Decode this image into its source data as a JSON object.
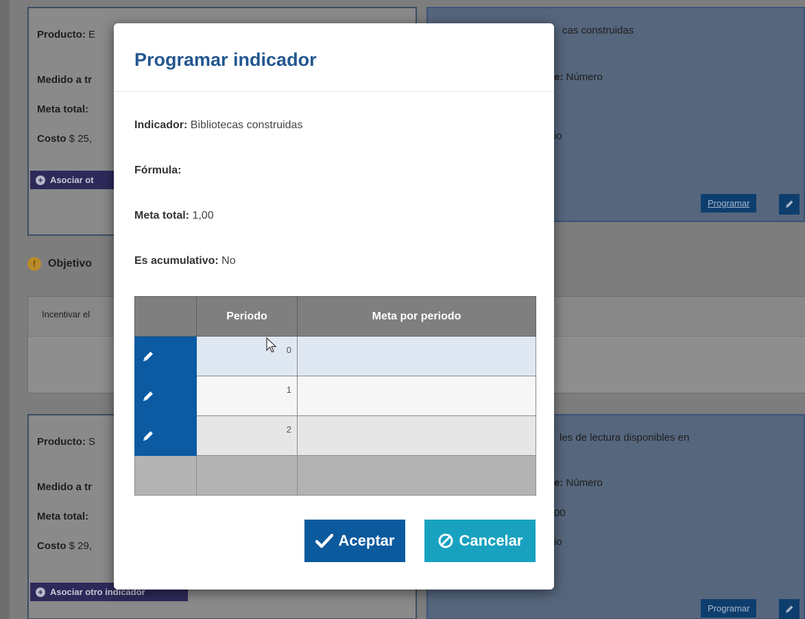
{
  "background": {
    "card1": {
      "producto_label": "Producto:",
      "producto_value": "E",
      "medido_label": "Medido a tr",
      "meta_label": "Meta total:",
      "costo_label": "Costo",
      "costo_value": "$ 25,",
      "assoc_label": "Asociar ot"
    },
    "card2": {
      "title_fragment": "cas construidas",
      "unidad_fragment": "e:",
      "unidad_value": "Número",
      "other_fragment": "io",
      "programar_label": "Programar"
    },
    "objective": {
      "label": "Objetivo",
      "text": "Incentivar el"
    },
    "card3": {
      "producto_label": "Producto:",
      "producto_value": "S",
      "medido_label": "Medido a tr",
      "meta_label": "Meta total:",
      "costo_label": "Costo",
      "costo_value": "$ 29,",
      "assoc_label": "Asociar otro indicador"
    },
    "card4": {
      "title_fragment": "les de lectura disponibles en",
      "unidad_fragment": "e:",
      "unidad_value": "Número",
      "value_fragment": "00",
      "other_fragment": "io",
      "programar_label": "Programar"
    }
  },
  "modal": {
    "title": "Programar indicador",
    "indicador": {
      "label": "Indicador:",
      "value": "Bibliotecas construidas"
    },
    "formula": {
      "label": "Fórmula:",
      "value": ""
    },
    "meta_total": {
      "label": "Meta total:",
      "value": "1,00"
    },
    "acumulativo": {
      "label": "Es acumulativo:",
      "value": "No"
    },
    "grid": {
      "columns": [
        "",
        "Periodo",
        "Meta por periodo"
      ],
      "rows": [
        {
          "periodo": "0",
          "meta": ""
        },
        {
          "periodo": "1",
          "meta": ""
        },
        {
          "periodo": "2",
          "meta": ""
        }
      ]
    },
    "buttons": {
      "accept": "Aceptar",
      "cancel": "Cancelar"
    }
  },
  "icons": {
    "edit": "pencil-icon",
    "accept": "check-icon",
    "cancel": "ban-icon",
    "add": "plus-circle-icon",
    "warning": "warning-icon",
    "cursor": "mouse-pointer"
  },
  "colors": {
    "accent": "#0b5a9e",
    "cancel": "#18a2bf",
    "title": "#23578f"
  }
}
